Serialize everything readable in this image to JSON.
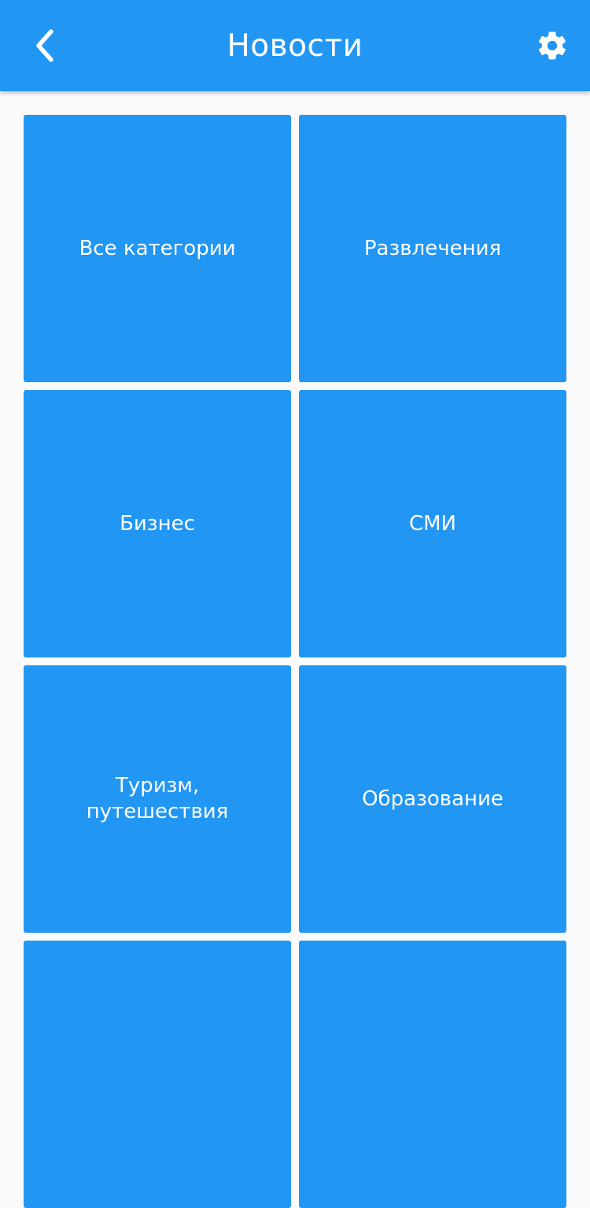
{
  "appbar": {
    "title": "Новости",
    "back_icon": "chevron-left-icon",
    "settings_icon": "gear-icon",
    "background_color": "#2196F3"
  },
  "tiles": [
    {
      "label": "Все категории"
    },
    {
      "label": "Развлечения"
    },
    {
      "label": "Бизнес"
    },
    {
      "label": "СМИ"
    },
    {
      "label": "Туризм,\nпутешествия"
    },
    {
      "label": "Образование"
    },
    {
      "label": ""
    },
    {
      "label": ""
    }
  ],
  "colors": {
    "tile": "#2196F3",
    "text": "#FFFFFF",
    "page_background": "#FAFAFA"
  }
}
